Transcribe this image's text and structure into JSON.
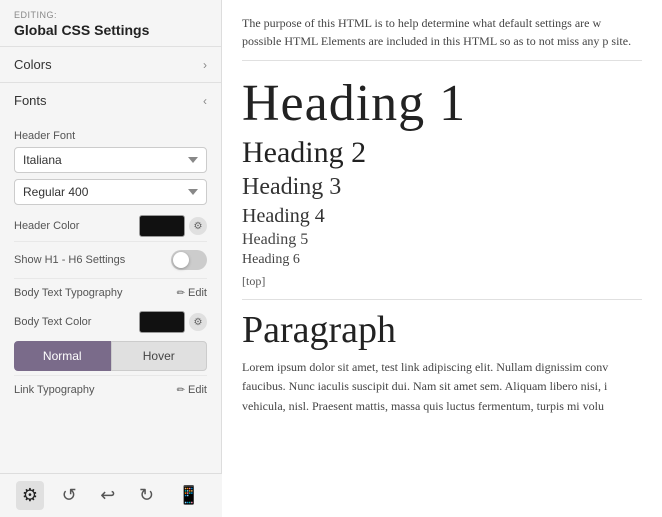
{
  "editing": {
    "label": "EDITING:",
    "title": "Global CSS Settings"
  },
  "colors_section": {
    "label": "Colors",
    "chevron": "›"
  },
  "fonts_section": {
    "label": "Fonts",
    "chevron": "‹"
  },
  "header_font": {
    "label": "Header Font",
    "font_value": "Italiana",
    "weight_value": "Regular 400"
  },
  "header_color": {
    "label": "Header Color"
  },
  "show_h1_h6": {
    "label": "Show H1 - H6 Settings"
  },
  "body_text_typography": {
    "label": "Body Text Typography",
    "edit_label": "Edit"
  },
  "body_text_color": {
    "label": "Body Text Color"
  },
  "link_tabs": {
    "normal_label": "Normal",
    "hover_label": "Hover"
  },
  "link_typography": {
    "label": "Link Typography",
    "edit_label": "Edit"
  },
  "toolbar": {
    "settings_icon": "⚙",
    "history_icon": "↺",
    "undo_icon": "↩",
    "redo_icon": "↻",
    "mobile_icon": "📱"
  },
  "preview": {
    "intro": "The purpose of this HTML is to help determine what default settings are w possible HTML Elements are included in this HTML so as to not miss any p site.",
    "h1": "Heading 1",
    "h2": "Heading 2",
    "h3": "Heading 3",
    "h4": "Heading 4",
    "h5": "Heading 5",
    "h6": "Heading 6",
    "top_link": "[top]",
    "paragraph_heading": "Paragraph",
    "paragraph": "Lorem ipsum dolor sit amet, test link adipiscing elit. Nullam dignissim conv faucibus. Nunc iaculis suscipit dui. Nam sit amet sem. Aliquam libero nisi, i vehicula, nisl. Praesent mattis, massa quis luctus fermentum, turpis mi volu"
  }
}
